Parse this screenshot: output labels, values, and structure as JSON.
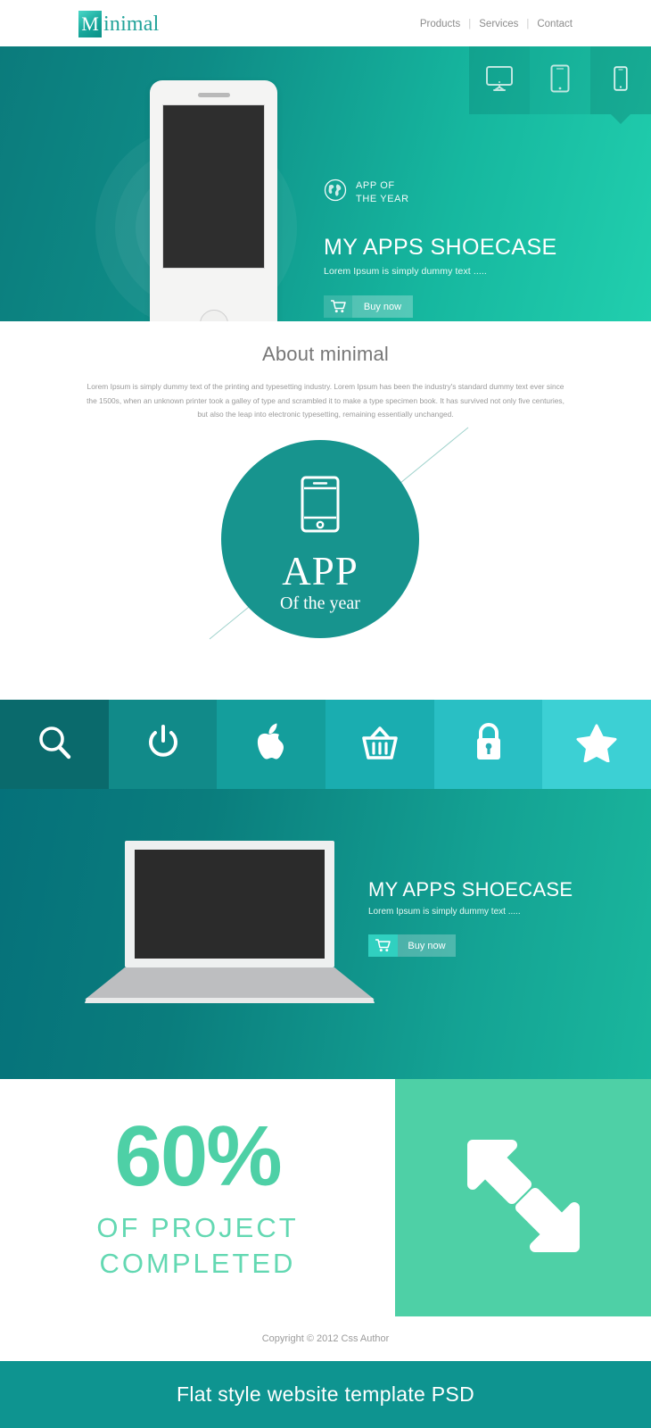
{
  "header": {
    "logo_initial": "M",
    "logo_text": "inimal",
    "nav": [
      {
        "label": "Products"
      },
      {
        "label": "Services"
      },
      {
        "label": "Contact"
      }
    ],
    "separator": "|"
  },
  "hero": {
    "device_tabs": [
      {
        "icon": "desktop-monitor-icon",
        "active": false
      },
      {
        "icon": "tablet-icon",
        "active": false
      },
      {
        "icon": "mobile-phone-icon",
        "active": true
      }
    ],
    "award_icon": "globe-icon",
    "award_line1": "APP OF",
    "award_line2": "THE YEAR",
    "title": "MY APPS SHOECASE",
    "subtitle": "Lorem Ipsum is simply dummy text .....",
    "buy_icon": "shopping-cart-icon",
    "buy_label": "Buy now"
  },
  "about": {
    "title": "About minimal",
    "body": "Lorem Ipsum is simply dummy text of the printing and typesetting industry. Lorem Ipsum has been the industry's standard dummy text ever since the 1500s, when an unknown printer took a galley of type and scrambled it to make a type specimen book. It has survived not only five centuries, but also the leap into electronic typesetting, remaining essentially unchanged.",
    "badge_icon": "mobile-phone-icon",
    "badge_title": "APP",
    "badge_subtitle": "Of the year"
  },
  "icon_bar": [
    {
      "name": "search-icon",
      "color": "#0a6a6c"
    },
    {
      "name": "power-icon",
      "color": "#118a89"
    },
    {
      "name": "apple-icon",
      "color": "#149e9c"
    },
    {
      "name": "shopping-basket-icon",
      "color": "#1aadb0"
    },
    {
      "name": "lock-icon",
      "color": "#29bfc4"
    },
    {
      "name": "star-icon",
      "color": "#3cd0d4"
    }
  ],
  "laptop_section": {
    "title": "MY APPS SHOECASE",
    "subtitle": "Lorem Ipsum is simply dummy text .....",
    "buy_icon": "shopping-cart-icon",
    "buy_label": "Buy now"
  },
  "stats": {
    "percent": "60%",
    "line1": "OF PROJECT",
    "line2": "COMPLETED",
    "arrows_icon": "resize-diagonal-arrows-icon",
    "panel_color": "#4ed0a6"
  },
  "footer": {
    "copyright": "Copyright © 2012 Css Author",
    "ribbon": "Flat style  website template PSD"
  },
  "colors": {
    "brand_teal": "#17948e",
    "hero_gradient_start": "#0b7b7c",
    "hero_gradient_end": "#21cfae",
    "mint": "#4ed0a6",
    "ribbon": "#0e9490"
  }
}
